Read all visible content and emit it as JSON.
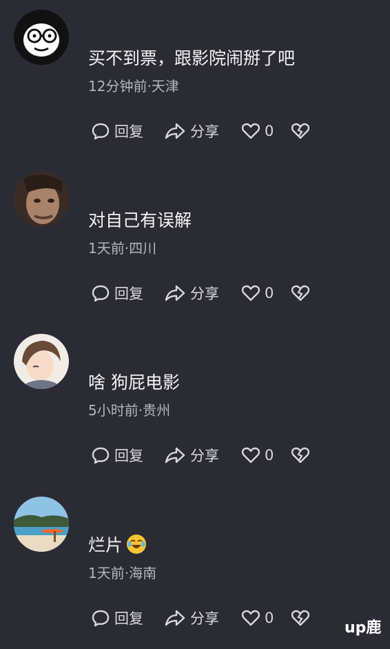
{
  "comments": [
    {
      "text": "买不到票，跟影院闹掰了吧",
      "meta": "12分钟前·天津",
      "reply_label": "回复",
      "share_label": "分享",
      "like_count": "0",
      "avatar_icon": "cartoon-glasses-avatar"
    },
    {
      "text": "对自己有误解",
      "meta": "1天前·四川",
      "reply_label": "回复",
      "share_label": "分享",
      "like_count": "0",
      "avatar_icon": "man-face-avatar"
    },
    {
      "text": "啥 狗屁电影",
      "meta": "5小时前·贵州",
      "reply_label": "回复",
      "share_label": "分享",
      "like_count": "0",
      "avatar_icon": "anime-boy-avatar"
    },
    {
      "text": "烂片",
      "meta": "1天前·海南",
      "reply_label": "回复",
      "share_label": "分享",
      "like_count": "0",
      "avatar_icon": "beach-avatar",
      "emoji": "laughing-crying-emoji"
    }
  ],
  "watermark": "up鹿",
  "colors": {
    "background": "#2b2b34",
    "text": "#f3f3f5",
    "meta": "#b5b5bd"
  }
}
